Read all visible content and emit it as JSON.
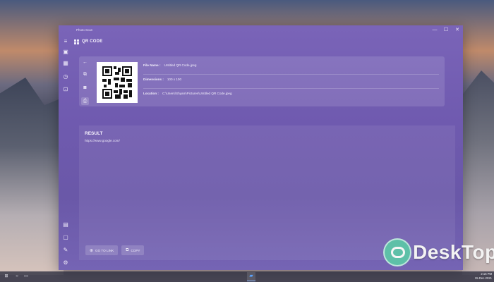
{
  "app": {
    "title": "Photo Scan",
    "controls": {
      "minimize": "—",
      "maximize": "☐",
      "close": "✕"
    }
  },
  "sidebar": {
    "top_items": [
      {
        "name": "menu-icon",
        "glyph": "≡"
      },
      {
        "name": "image-icon",
        "glyph": "▣"
      },
      {
        "name": "qr-code-icon",
        "glyph": "▦"
      },
      {
        "name": "history-icon",
        "glyph": "◷"
      },
      {
        "name": "scan-icon",
        "glyph": "⊡"
      }
    ],
    "bottom_items": [
      {
        "name": "notes-icon",
        "glyph": "▤"
      },
      {
        "name": "clipboard-icon",
        "glyph": "▢"
      },
      {
        "name": "feedback-icon",
        "glyph": "✎"
      },
      {
        "name": "settings-icon",
        "glyph": "⚙"
      }
    ]
  },
  "header": {
    "label": "QR CODE"
  },
  "tools": {
    "back": "←",
    "copy_image": "⧉",
    "camera": "◙",
    "save": "⎙"
  },
  "file": {
    "name_label": "File Name :",
    "name_value": "Untitled QR Code.jpeg",
    "dimensions_label": "Dimensions :",
    "dimensions_value": "100 x 100",
    "location_label": "Location :",
    "location_value": "C:\\Users\\Shyam\\Pictures\\Untitled QR Code.jpeg"
  },
  "result": {
    "title": "RESULT",
    "text": "https://www.google.com/"
  },
  "actions": {
    "go_to_link": "GO TO LINK",
    "go_to_link_icon": "⊕",
    "copy": "COPY",
    "copy_icon": "⧉"
  },
  "taskbar": {
    "start": "⊞",
    "search": "○",
    "task_view": "▭",
    "app_icon": "▰",
    "time": "2:15 PM",
    "date": "15-Dec-2021"
  },
  "watermark": {
    "text": "DeskTop"
  }
}
